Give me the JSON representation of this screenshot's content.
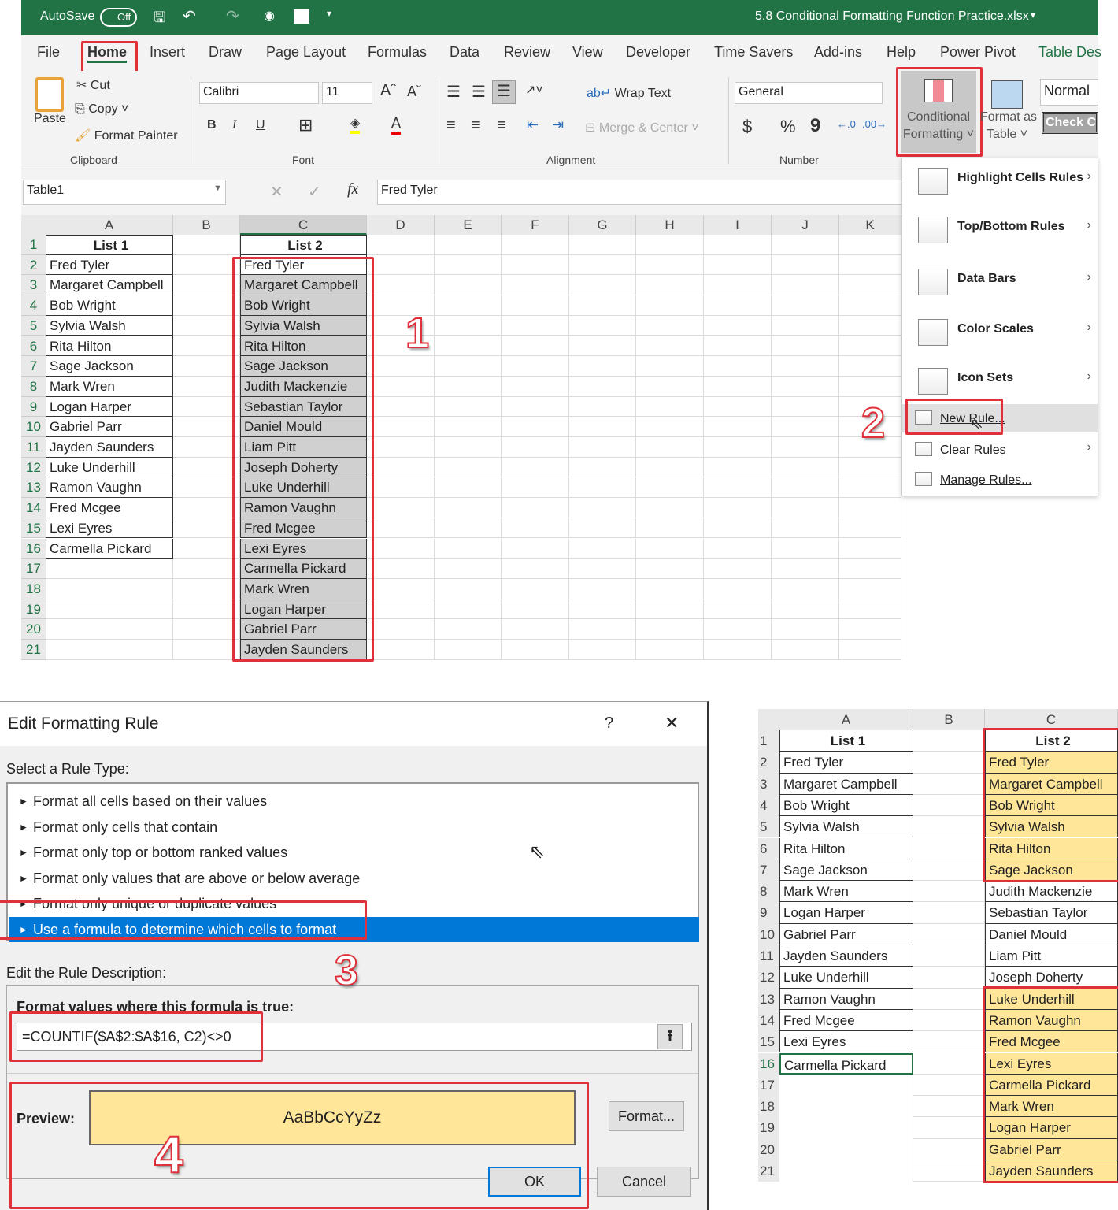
{
  "titlebar": {
    "autosave": "AutoSave",
    "toggle": "Off",
    "filename": "5.8 Conditional Formatting Function Practice.xlsx"
  },
  "tabs": [
    "File",
    "Home",
    "Insert",
    "Draw",
    "Page Layout",
    "Formulas",
    "Data",
    "Review",
    "View",
    "Developer",
    "Time Savers",
    "Add-ins",
    "Help",
    "Power Pivot",
    "Table Des"
  ],
  "ribbon": {
    "paste": "Paste",
    "cut": "Cut",
    "copy": "Copy",
    "format_painter": "Format Painter",
    "clipboard": "Clipboard",
    "font_name": "Calibri",
    "font_size": "11",
    "bold": "B",
    "italic": "I",
    "underline": "U",
    "font": "Font",
    "wrap_text": "Wrap Text",
    "merge_center": "Merge & Center",
    "alignment": "Alignment",
    "number_format": "General",
    "currency": "$",
    "percent": "%",
    "comma": "9",
    "number": "Number",
    "cond_fmt_1": "Conditional",
    "cond_fmt_2": "Formatting",
    "fmt_table_1": "Format as",
    "fmt_table_2": "Table",
    "style_normal": "Normal",
    "style_check": "Check C"
  },
  "formula_bar": {
    "name_box": "Table1",
    "fx": "fx",
    "value": "Fred Tyler"
  },
  "columns": [
    "A",
    "B",
    "C",
    "D",
    "E",
    "F",
    "G",
    "H",
    "I",
    "J",
    "K"
  ],
  "list1": [
    "List 1",
    "Fred Tyler",
    "Margaret Campbell",
    "Bob Wright",
    "Sylvia Walsh",
    "Rita Hilton",
    "Sage Jackson",
    "Mark Wren",
    "Logan Harper",
    "Gabriel Parr",
    "Jayden Saunders",
    "Luke Underhill",
    "Ramon Vaughn",
    "Fred Mcgee",
    "Lexi Eyres",
    "Carmella Pickard"
  ],
  "list2": [
    "List 2",
    "Fred Tyler",
    "Margaret Campbell",
    "Bob Wright",
    "Sylvia Walsh",
    "Rita Hilton",
    "Sage Jackson",
    "Judith Mackenzie",
    "Sebastian Taylor",
    "Daniel Mould",
    "Liam Pitt",
    "Joseph Doherty",
    "Luke Underhill",
    "Ramon Vaughn",
    "Fred Mcgee",
    "Lexi Eyres",
    "Carmella Pickard",
    "Mark Wren",
    "Logan Harper",
    "Gabriel Parr",
    "Jayden Saunders"
  ],
  "menu": [
    {
      "label": "Highlight Cells Rules",
      "icon": "highlight-cells-icon"
    },
    {
      "label": "Top/Bottom Rules",
      "icon": "top-bottom-icon"
    },
    {
      "label": "Data Bars",
      "icon": "data-bars-icon"
    },
    {
      "label": "Color Scales",
      "icon": "color-scales-icon"
    },
    {
      "label": "Icon Sets",
      "icon": "icon-sets-icon"
    },
    {
      "label": "New Rule...",
      "icon": "new-rule-icon"
    },
    {
      "label": "Clear Rules",
      "icon": "clear-rules-icon"
    },
    {
      "label": "Manage Rules...",
      "icon": "manage-rules-icon"
    }
  ],
  "steps": [
    "1",
    "2",
    "3",
    "4"
  ],
  "dialog": {
    "title": "Edit Formatting Rule",
    "help": "?",
    "close": "✕",
    "select_type": "Select a Rule Type:",
    "rule_types": [
      "Format all cells based on their values",
      "Format only cells that contain",
      "Format only top or bottom ranked values",
      "Format only values that are above or below average",
      "Format only unique or duplicate values",
      "Use a formula to determine which cells to format"
    ],
    "selected_index": 5,
    "edit_desc": "Edit the Rule Description:",
    "formula_label": "Format values where this formula is true:",
    "formula": "=COUNTIF($A$2:$A$16, C2)<>0",
    "preview_label": "Preview:",
    "preview_text": "AaBbCcYyZz",
    "format_btn": "Format...",
    "ok": "OK",
    "cancel": "Cancel"
  },
  "result": {
    "highlighted_rows": [
      2,
      3,
      4,
      5,
      6,
      7,
      13,
      14,
      15,
      16,
      17,
      18,
      19,
      20,
      21
    ]
  },
  "colors": {
    "excel_green": "#217346",
    "highlight": "#ffe699",
    "selected": "#0078d7",
    "annotation": "#e0303a"
  }
}
